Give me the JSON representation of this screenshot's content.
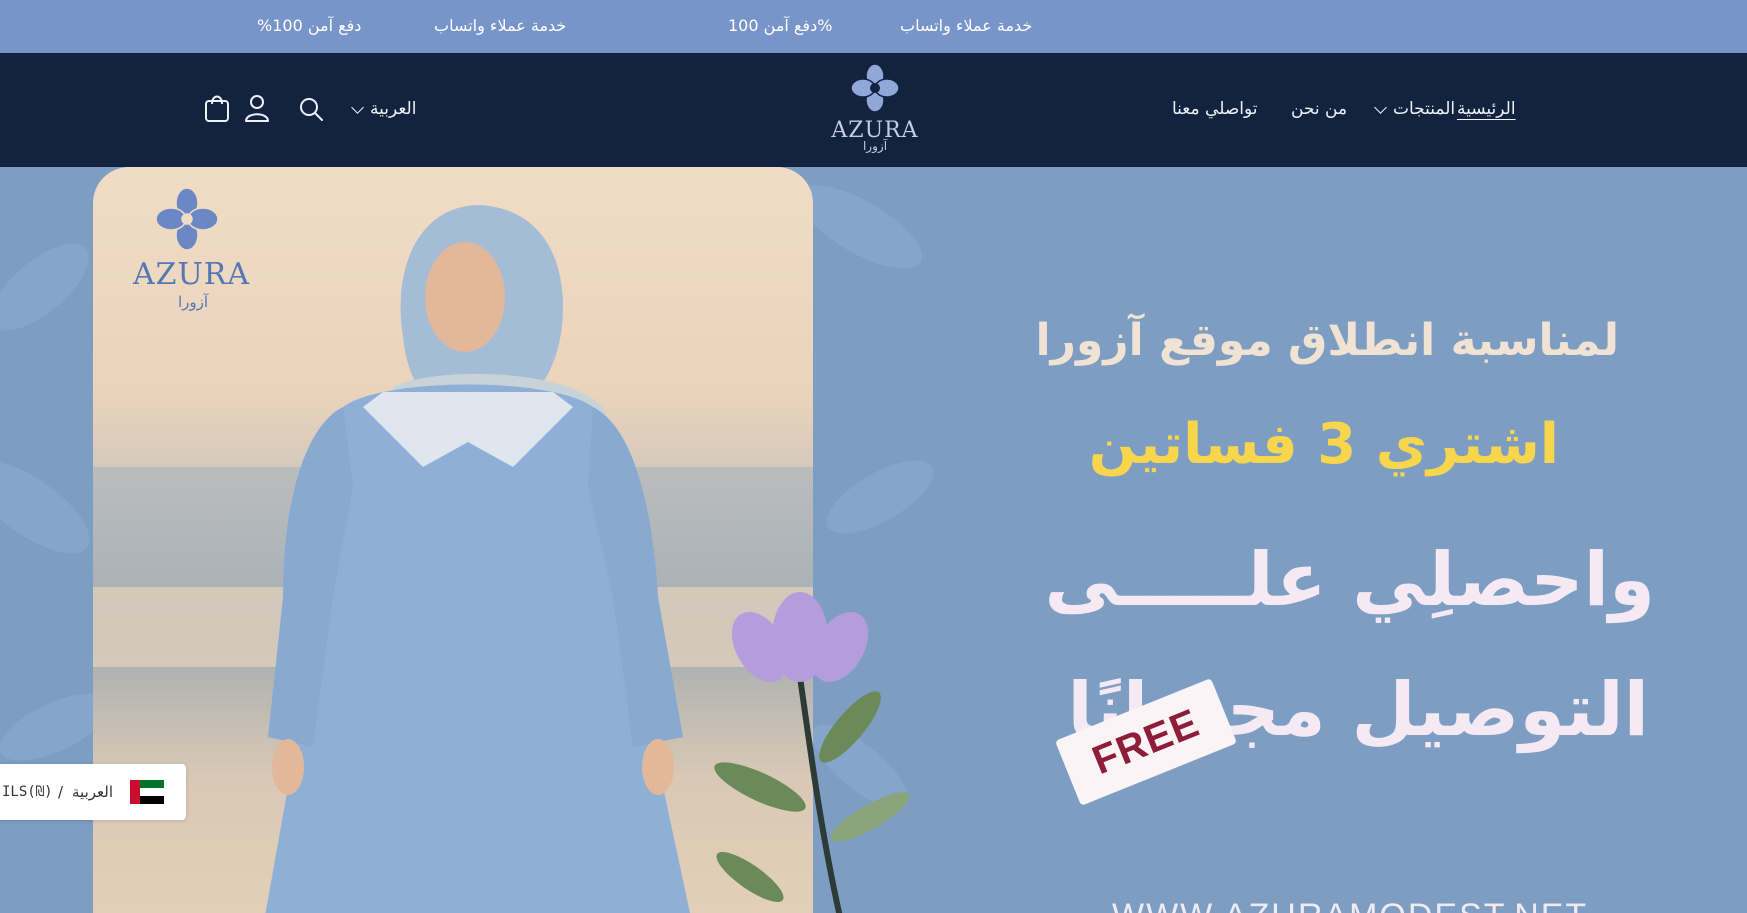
{
  "announcement_bar": {
    "items": [
      "خدمة عملاء واتساب",
      "%دفع آمن 100",
      "خدمة عملاء واتساب",
      "دفع آمن 100%"
    ]
  },
  "header": {
    "nav": {
      "home": "الرئيسية",
      "products": "المنتجات",
      "about": "من نحن",
      "contact": "تواصلي معنا"
    },
    "logo": {
      "word": "AZURA",
      "sub": "آزورا"
    },
    "language_select": "العربية"
  },
  "hero": {
    "card_logo": {
      "word": "AZURA",
      "sub": "آزورا"
    },
    "line1": "لمناسبة انطلاق موقع آزورا",
    "line2": "اشتري 3 فساتين",
    "line3": "واحصلِي علـــــى",
    "line4": "التوصيل مجـــانًا",
    "free_tag": "FREE",
    "url": "WWW.AZURAMODEST.NET"
  },
  "locale_switcher": {
    "language": "العربية",
    "separator": "/",
    "currency": "ILS(₪)"
  },
  "colors": {
    "announce_bg": "#7895c9",
    "header_bg": "#12223f",
    "hero_bg": "#7d9dc3",
    "highlight_yellow": "#f7d54d",
    "free_red": "#8e1d3a"
  },
  "icons": [
    "logo-flower-icon",
    "chevron-down-icon",
    "search-icon",
    "account-icon",
    "cart-icon",
    "uae-flag-icon"
  ]
}
